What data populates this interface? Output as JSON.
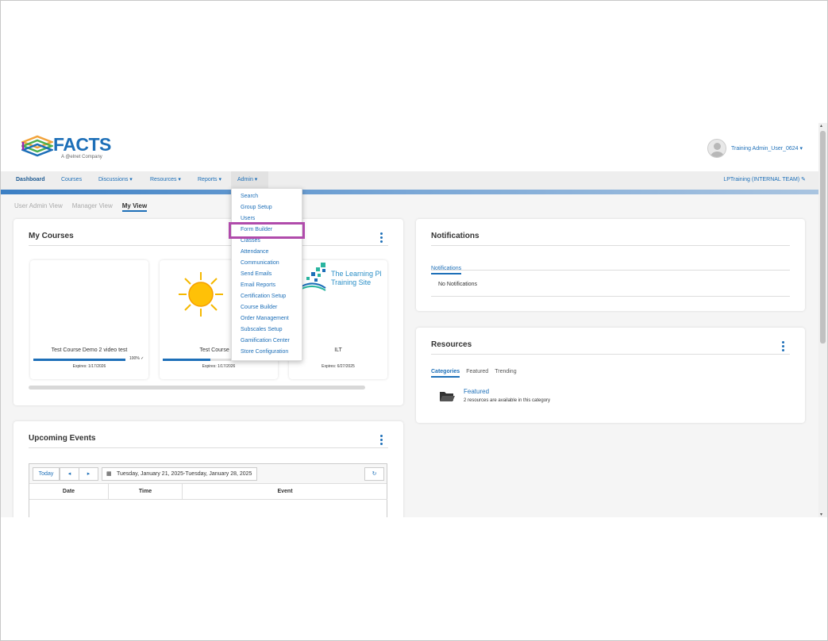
{
  "header": {
    "brand": "FACTS",
    "brand_sub": "A @elnet Company",
    "user_name": "Training Admin_User_0624 ▾"
  },
  "nav": {
    "items": [
      "Dashboard",
      "Courses",
      "Discussions ▾",
      "Resources ▾",
      "Reports ▾",
      "Admin ▾"
    ],
    "org": "LPTraining (INTERNAL TEAM)"
  },
  "views": [
    "User Admin View",
    "Manager View",
    "My View"
  ],
  "admin_menu": [
    "Search",
    "Group Setup",
    "Users",
    "Form Builder",
    "Classes",
    "Attendance",
    "Communication",
    "Send Emails",
    "Email Reports",
    "Certification Setup",
    "Course Builder",
    "Order Management",
    "Subscales Setup",
    "Gamification Center",
    "Store Configuration"
  ],
  "my_courses": {
    "title": "My Courses",
    "tiles": [
      {
        "name": "Test Course Demo 2 video test",
        "progress_pct": 100,
        "progress_label": "100% ✓",
        "expires": "Expires: 1/17/2026"
      },
      {
        "name": "Test Course De",
        "progress_pct": 52,
        "expires": "Expires: 1/17/2026"
      },
      {
        "name": "ILT",
        "expires": "Expires: 6/27/2025",
        "logo_line1": "The Learning Pl",
        "logo_line2": "Training Site"
      }
    ]
  },
  "notifications": {
    "title": "Notifications",
    "tab": "Notifications",
    "empty": "No Notifications"
  },
  "resources": {
    "title": "Resources",
    "tabs": [
      "Categories",
      "Featured",
      "Trending"
    ],
    "item_name": "Featured",
    "item_desc": "2 resources are available in this category"
  },
  "events": {
    "title": "Upcoming Events",
    "today": "Today",
    "prev": "◂",
    "next": "▸",
    "range": "Tuesday, January 21, 2025-Tuesday, January 28, 2025",
    "columns": [
      "Date",
      "Time",
      "Event"
    ]
  },
  "colors": {
    "accent": "#1d6fb8",
    "highlight": "#b04bab"
  }
}
